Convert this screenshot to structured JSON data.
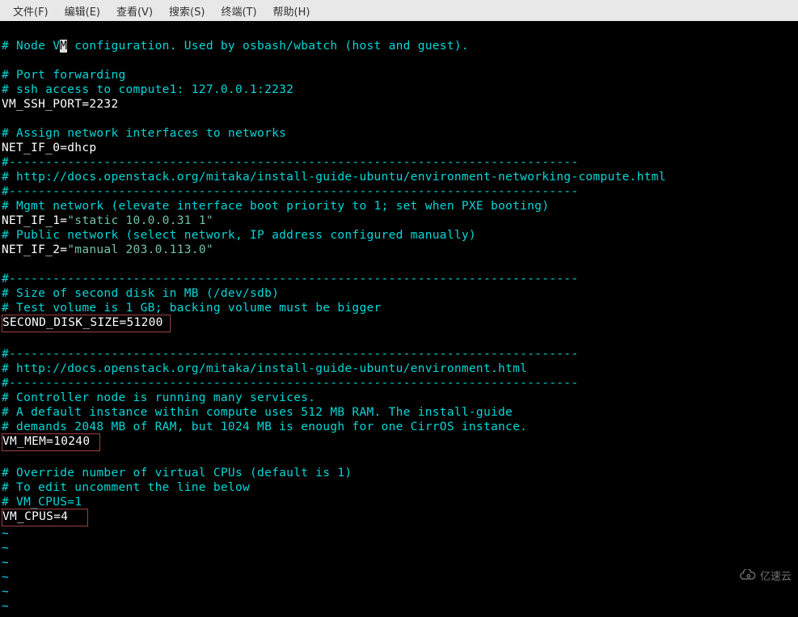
{
  "menubar": {
    "file": "文件(F)",
    "edit": "编辑(E)",
    "view": "查看(V)",
    "search": "搜索(S)",
    "terminal": "终端(T)",
    "help": "帮助(H)"
  },
  "code": {
    "l1_a": "# Node V",
    "l1_cursor": "M",
    "l1_b": " configuration. Used by osbash/wbatch (host and guest).",
    "l2": "",
    "l3": "# Port forwarding",
    "l4": "# ssh access to compute1: 127.0.0.1:2232",
    "l5": "VM_SSH_PORT=2232",
    "l6": "",
    "l7": "# Assign network interfaces to networks",
    "l8": "NET_IF_0=dhcp",
    "l9": "#------------------------------------------------------------------------------",
    "l10": "# http://docs.openstack.org/mitaka/install-guide-ubuntu/environment-networking-compute.html",
    "l11": "#------------------------------------------------------------------------------",
    "l12": "# Mgmt network (elevate interface boot priority to 1; set when PXE booting)",
    "l13a": "NET_IF_1=",
    "l13b": "\"static 10.0.0.31 1\"",
    "l14": "# Public network (select network, IP address configured manually)",
    "l15a": "NET_IF_2=",
    "l15b": "\"manual 203.0.113.0\"",
    "l16": "",
    "l17": "#------------------------------------------------------------------------------",
    "l18": "# Size of second disk in MB (/dev/sdb)",
    "l19": "# Test volume is 1 GB; backing volume must be bigger",
    "l20": "SECOND_DISK_SIZE=51200",
    "l21": "",
    "l22": "#------------------------------------------------------------------------------",
    "l23": "# http://docs.openstack.org/mitaka/install-guide-ubuntu/environment.html",
    "l24": "#------------------------------------------------------------------------------",
    "l25": "# Controller node is running many services.",
    "l26": "# A default instance within compute uses 512 MB RAM. The install-guide",
    "l27": "# demands 2048 MB of RAM, but 1024 MB is enough for one CirrOS instance.",
    "l28": "VM_MEM=10240",
    "l29": "",
    "l30": "# Override number of virtual CPUs (default is 1)",
    "l31": "# To edit uncomment the line below",
    "l32": "# VM_CPUS=1",
    "l33": "VM_CPUS=4",
    "tilde": "~"
  },
  "watermark": "亿速云"
}
